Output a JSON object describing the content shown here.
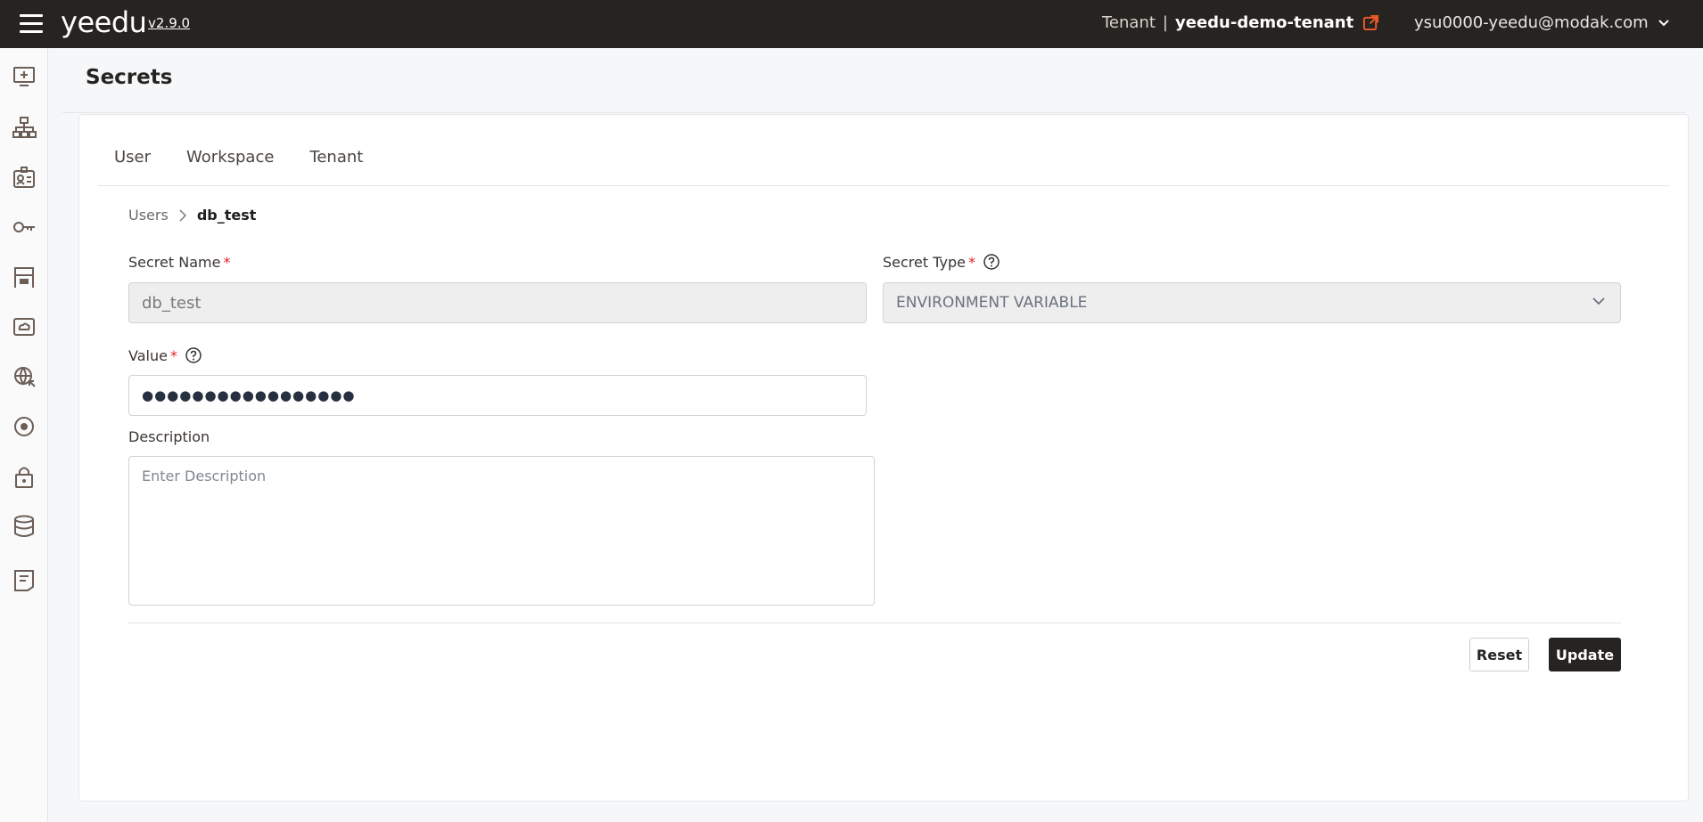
{
  "header": {
    "logo": "yeedu",
    "version": "v2.9.0",
    "tenant_label": "Tenant",
    "tenant_separator": "|",
    "tenant_name": "yeedu-demo-tenant",
    "user_email": "ysu0000-yeedu@modak.com",
    "accent_color": "#f05a28",
    "bar_color": "#262320"
  },
  "sidebar": {
    "items": [
      {
        "icon": "add-screen-icon"
      },
      {
        "icon": "hierarchy-icon"
      },
      {
        "icon": "id-card-icon"
      },
      {
        "icon": "key-icon"
      },
      {
        "icon": "warehouse-icon"
      },
      {
        "icon": "cloud-drive-icon"
      },
      {
        "icon": "globe-icon"
      },
      {
        "icon": "target-icon"
      },
      {
        "icon": "lock-icon"
      },
      {
        "icon": "database-icon"
      },
      {
        "icon": "notes-icon"
      }
    ]
  },
  "page": {
    "title": "Secrets"
  },
  "tabs": [
    {
      "label": "User"
    },
    {
      "label": "Workspace"
    },
    {
      "label": "Tenant"
    }
  ],
  "breadcrumb": {
    "parent": "Users",
    "current": "db_test"
  },
  "form": {
    "secret_name_label": "Secret Name",
    "secret_name_value": "db_test",
    "secret_type_label": "Secret Type",
    "secret_type_value": "ENVIRONMENT VARIABLE",
    "value_label": "Value",
    "value_masked": "●●●●●●●●●●●●●●●●●",
    "description_label": "Description",
    "description_placeholder": "Enter Description",
    "required_mark": "*"
  },
  "actions": {
    "reset_label": "Reset",
    "update_label": "Update"
  }
}
